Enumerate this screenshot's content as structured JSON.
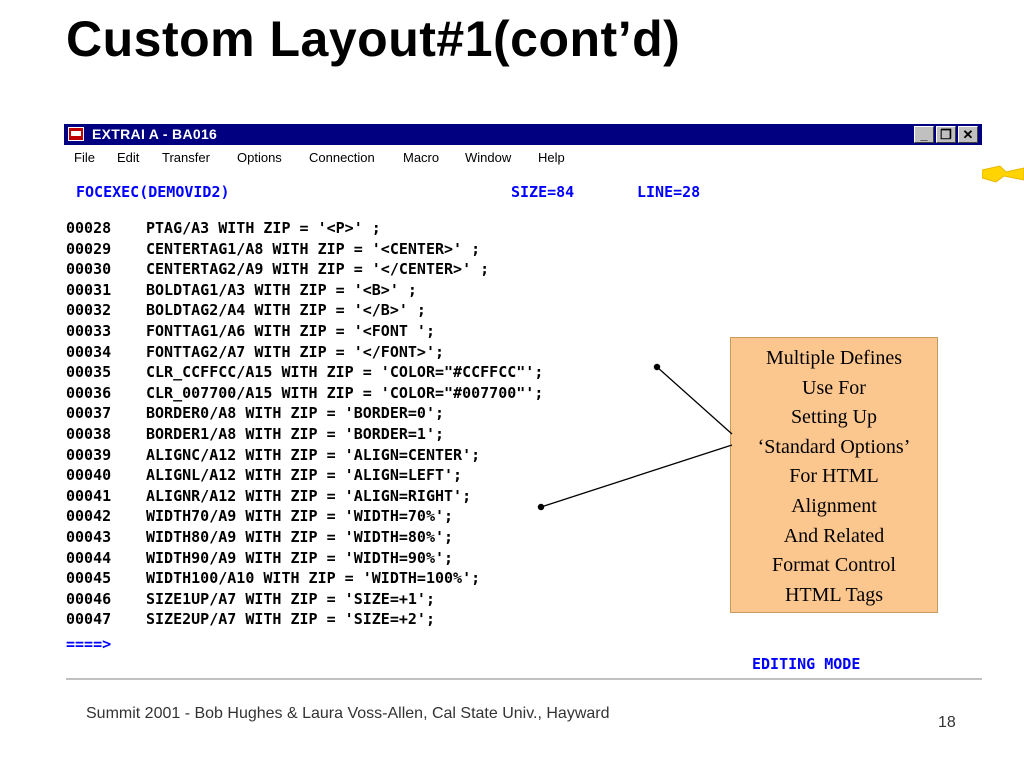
{
  "slide": {
    "title": "Custom Layout#1(cont’d)",
    "footer": "Summit 2001 - Bob Hughes & Laura Voss-Allen, Cal State Univ., Hayward",
    "page_number": "18"
  },
  "window": {
    "title": "EXTRAI A - BA016",
    "controls": {
      "minimize": "_",
      "restore": "❐",
      "close": "✕"
    }
  },
  "menu": {
    "items": [
      "File",
      "Edit",
      "Transfer",
      "Options",
      "Connection",
      "Macro",
      "Window",
      "Help"
    ]
  },
  "terminal": {
    "header": "FOCEXEC(DEMOVID2)",
    "size": "SIZE=84",
    "line": "LINE=28",
    "lines": [
      {
        "num": "00028",
        "code": "PTAG/A3 WITH ZIP = '<P>' ;"
      },
      {
        "num": "00029",
        "code": "CENTERTAG1/A8 WITH ZIP = '<CENTER>' ;"
      },
      {
        "num": "00030",
        "code": "CENTERTAG2/A9 WITH ZIP = '</CENTER>' ;"
      },
      {
        "num": "00031",
        "code": "BOLDTAG1/A3 WITH ZIP = '<B>' ;"
      },
      {
        "num": "00032",
        "code": "BOLDTAG2/A4 WITH ZIP = '</B>' ;"
      },
      {
        "num": "00033",
        "code": "FONTTAG1/A6 WITH ZIP = '<FONT ';"
      },
      {
        "num": "00034",
        "code": "FONTTAG2/A7 WITH ZIP = '</FONT>';"
      },
      {
        "num": "00035",
        "code": "CLR_CCFFCC/A15 WITH ZIP = 'COLOR=\"#CCFFCC\"';"
      },
      {
        "num": "00036",
        "code": "CLR_007700/A15 WITH ZIP = 'COLOR=\"#007700\"';"
      },
      {
        "num": "00037",
        "code": "BORDER0/A8 WITH ZIP = 'BORDER=0';"
      },
      {
        "num": "00038",
        "code": "BORDER1/A8 WITH ZIP = 'BORDER=1';"
      },
      {
        "num": "00039",
        "code": "ALIGNC/A12 WITH ZIP = 'ALIGN=CENTER';"
      },
      {
        "num": "00040",
        "code": "ALIGNL/A12 WITH ZIP = 'ALIGN=LEFT';"
      },
      {
        "num": "00041",
        "code": "ALIGNR/A12 WITH ZIP = 'ALIGN=RIGHT';"
      },
      {
        "num": "00042",
        "code": "WIDTH70/A9 WITH ZIP = 'WIDTH=70%';"
      },
      {
        "num": "00043",
        "code": "WIDTH80/A9 WITH ZIP = 'WIDTH=80%';"
      },
      {
        "num": "00044",
        "code": "WIDTH90/A9 WITH ZIP = 'WIDTH=90%';"
      },
      {
        "num": "00045",
        "code": "WIDTH100/A10 WITH ZIP = 'WIDTH=100%';"
      },
      {
        "num": "00046",
        "code": "SIZE1UP/A7 WITH ZIP = 'SIZE=+1';"
      },
      {
        "num": "00047",
        "code": "SIZE2UP/A7 WITH ZIP = 'SIZE=+2';"
      }
    ],
    "prompt": "====>",
    "mode": "EDITING MODE"
  },
  "callout": {
    "lines": [
      "Multiple Defines",
      "Use For",
      "Setting Up",
      "‘Standard Options’",
      "For HTML",
      "Alignment",
      "And Related",
      "Format Control",
      "HTML Tags"
    ]
  },
  "colors": {
    "titlebar": "#000080",
    "terminal_blue": "#0000ff",
    "callout_bg": "#fcc78f",
    "accent_yellow": "#ffd400"
  }
}
